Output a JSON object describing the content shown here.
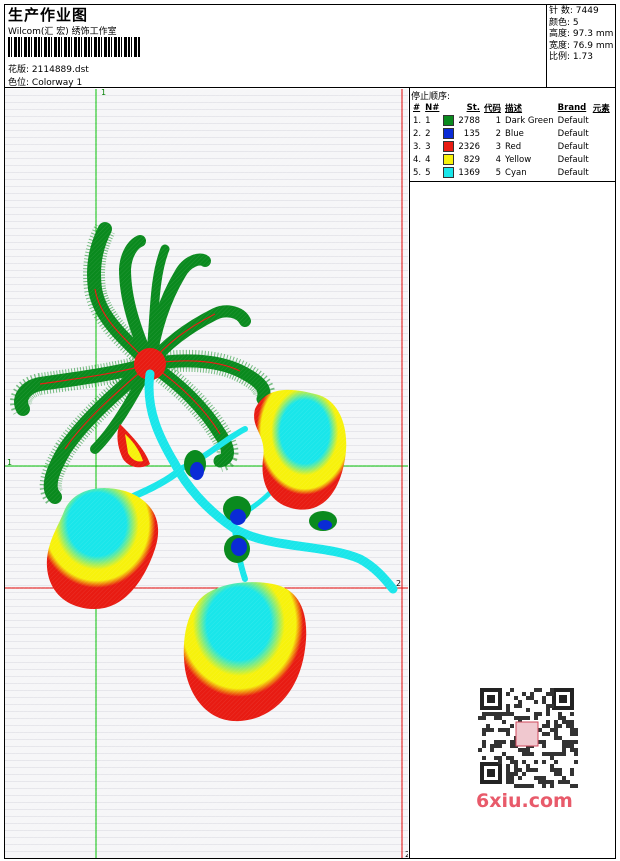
{
  "header": {
    "title": "生产作业图",
    "subtitle": "Wilcom(汇 宏) 绣饰工作室",
    "design_label": "花版:",
    "design_value": "2114889.dst",
    "colorway_label": "色位:",
    "colorway_value": "Colorway 1"
  },
  "stats": {
    "stitches_label": "针 数:",
    "stitches_value": "7449",
    "colors_label": "颜色:",
    "colors_value": "5",
    "height_label": "高度:",
    "height_value": "97.3 mm",
    "width_label": "宽度:",
    "width_value": "76.9 mm",
    "ratio_label": "比例:",
    "ratio_value": "1.73"
  },
  "markers": {
    "top_1": "1",
    "left_1": "1",
    "right_2": "2",
    "bottom_2": "2"
  },
  "stop_sequence": {
    "title": "停止顺序:",
    "headers": [
      "#",
      "N#",
      "St.",
      "代码",
      "描述",
      "Brand",
      "元素"
    ],
    "rows": [
      {
        "idx": "1.",
        "n": "1",
        "st": "2788",
        "code": "1",
        "desc": "Dark Green",
        "brand": "Default",
        "color": "#0a8a1e"
      },
      {
        "idx": "2.",
        "n": "2",
        "st": "135",
        "code": "2",
        "desc": "Blue",
        "brand": "Default",
        "color": "#0a2bd6"
      },
      {
        "idx": "3.",
        "n": "3",
        "st": "2326",
        "code": "3",
        "desc": "Red",
        "brand": "Default",
        "color": "#e81b12"
      },
      {
        "idx": "4.",
        "n": "4",
        "st": "829",
        "code": "4",
        "desc": "Yellow",
        "brand": "Default",
        "color": "#f7f20c"
      },
      {
        "idx": "5.",
        "n": "5",
        "st": "1369",
        "code": "5",
        "desc": "Cyan",
        "brand": "Default",
        "color": "#19e6ea"
      }
    ]
  },
  "watermark": "6xiu.com",
  "colors": {
    "dark_green": "#0a8a1e",
    "blue": "#0a2bd6",
    "red": "#e81b12",
    "yellow": "#f7f20c",
    "cyan": "#19e6ea",
    "guide_green": "#00c000",
    "guide_red": "#e00000"
  }
}
